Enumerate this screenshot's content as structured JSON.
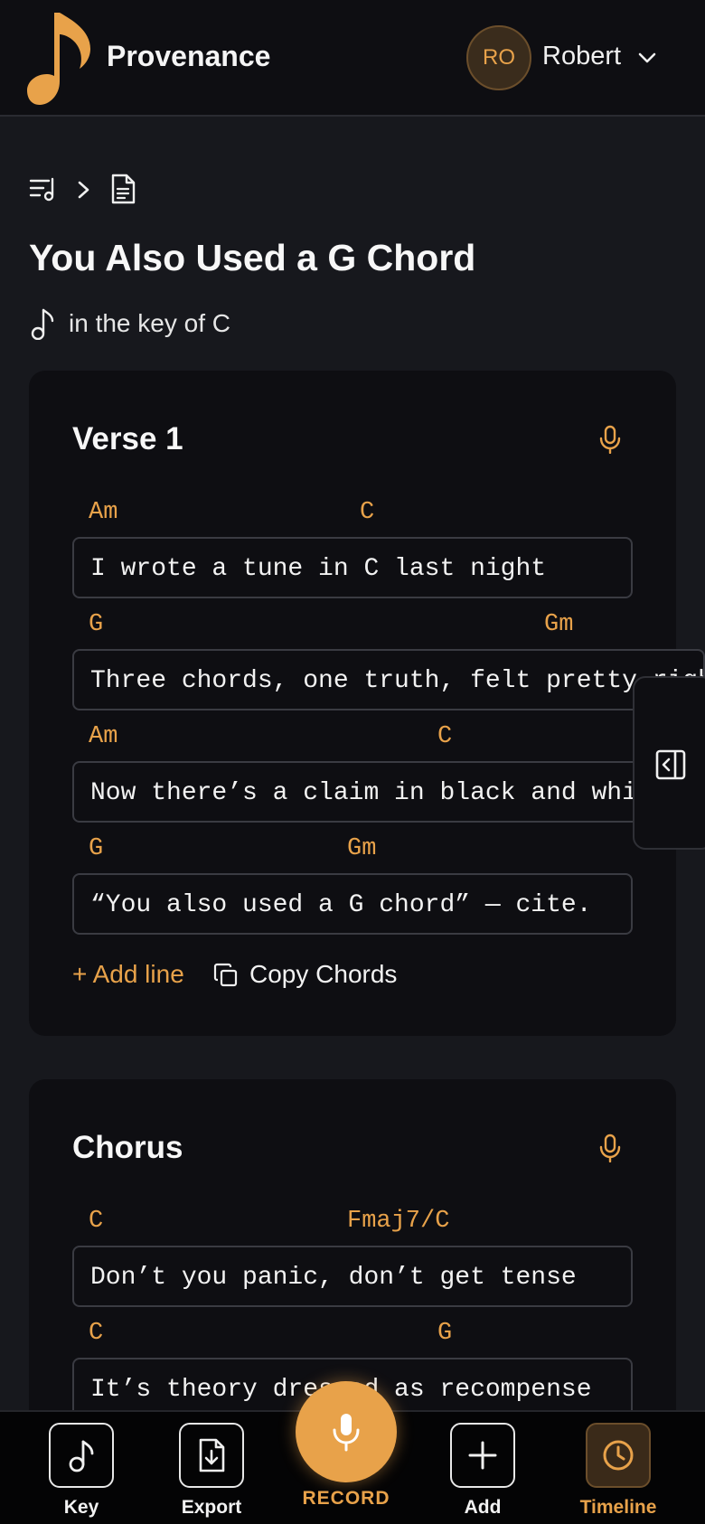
{
  "header": {
    "brand": "Provenance",
    "avatar_initials": "RO",
    "user_name": "Robert",
    "accent_color": "#e8a24a"
  },
  "breadcrumb": {
    "icons": [
      "song-list-icon",
      "chevron-right-icon",
      "document-icon"
    ]
  },
  "song": {
    "title": "You Also Used a G Chord",
    "key_label": "in the key of C"
  },
  "sections": [
    {
      "title": "Verse 1",
      "lines": [
        {
          "chords": [
            "Am",
            "C"
          ],
          "lyric": "I wrote a tune in C last night"
        },
        {
          "chords": [
            "G",
            "Gm"
          ],
          "lyric": "Three chords, one truth, felt pretty right"
        },
        {
          "chords": [
            "Am",
            "C"
          ],
          "lyric": "Now there’s a claim in black and white"
        },
        {
          "chords": [
            "G",
            "Gm"
          ],
          "lyric": "“You also used a G chord” — cite."
        }
      ],
      "add_line_label": "+ Add line",
      "copy_chords_label": "Copy Chords"
    },
    {
      "title": "Chorus",
      "lines": [
        {
          "chords": [
            "C",
            "Fmaj7/C"
          ],
          "lyric": "Don’t you panic, don’t get tense"
        },
        {
          "chords": [
            "C",
            "G"
          ],
          "lyric": "It’s theory dressed as recompense"
        }
      ]
    }
  ],
  "bottom_nav": {
    "key_label": "Key",
    "export_label": "Export",
    "record_label": "RECORD",
    "add_label": "Add",
    "timeline_label": "Timeline",
    "active": "Timeline"
  }
}
